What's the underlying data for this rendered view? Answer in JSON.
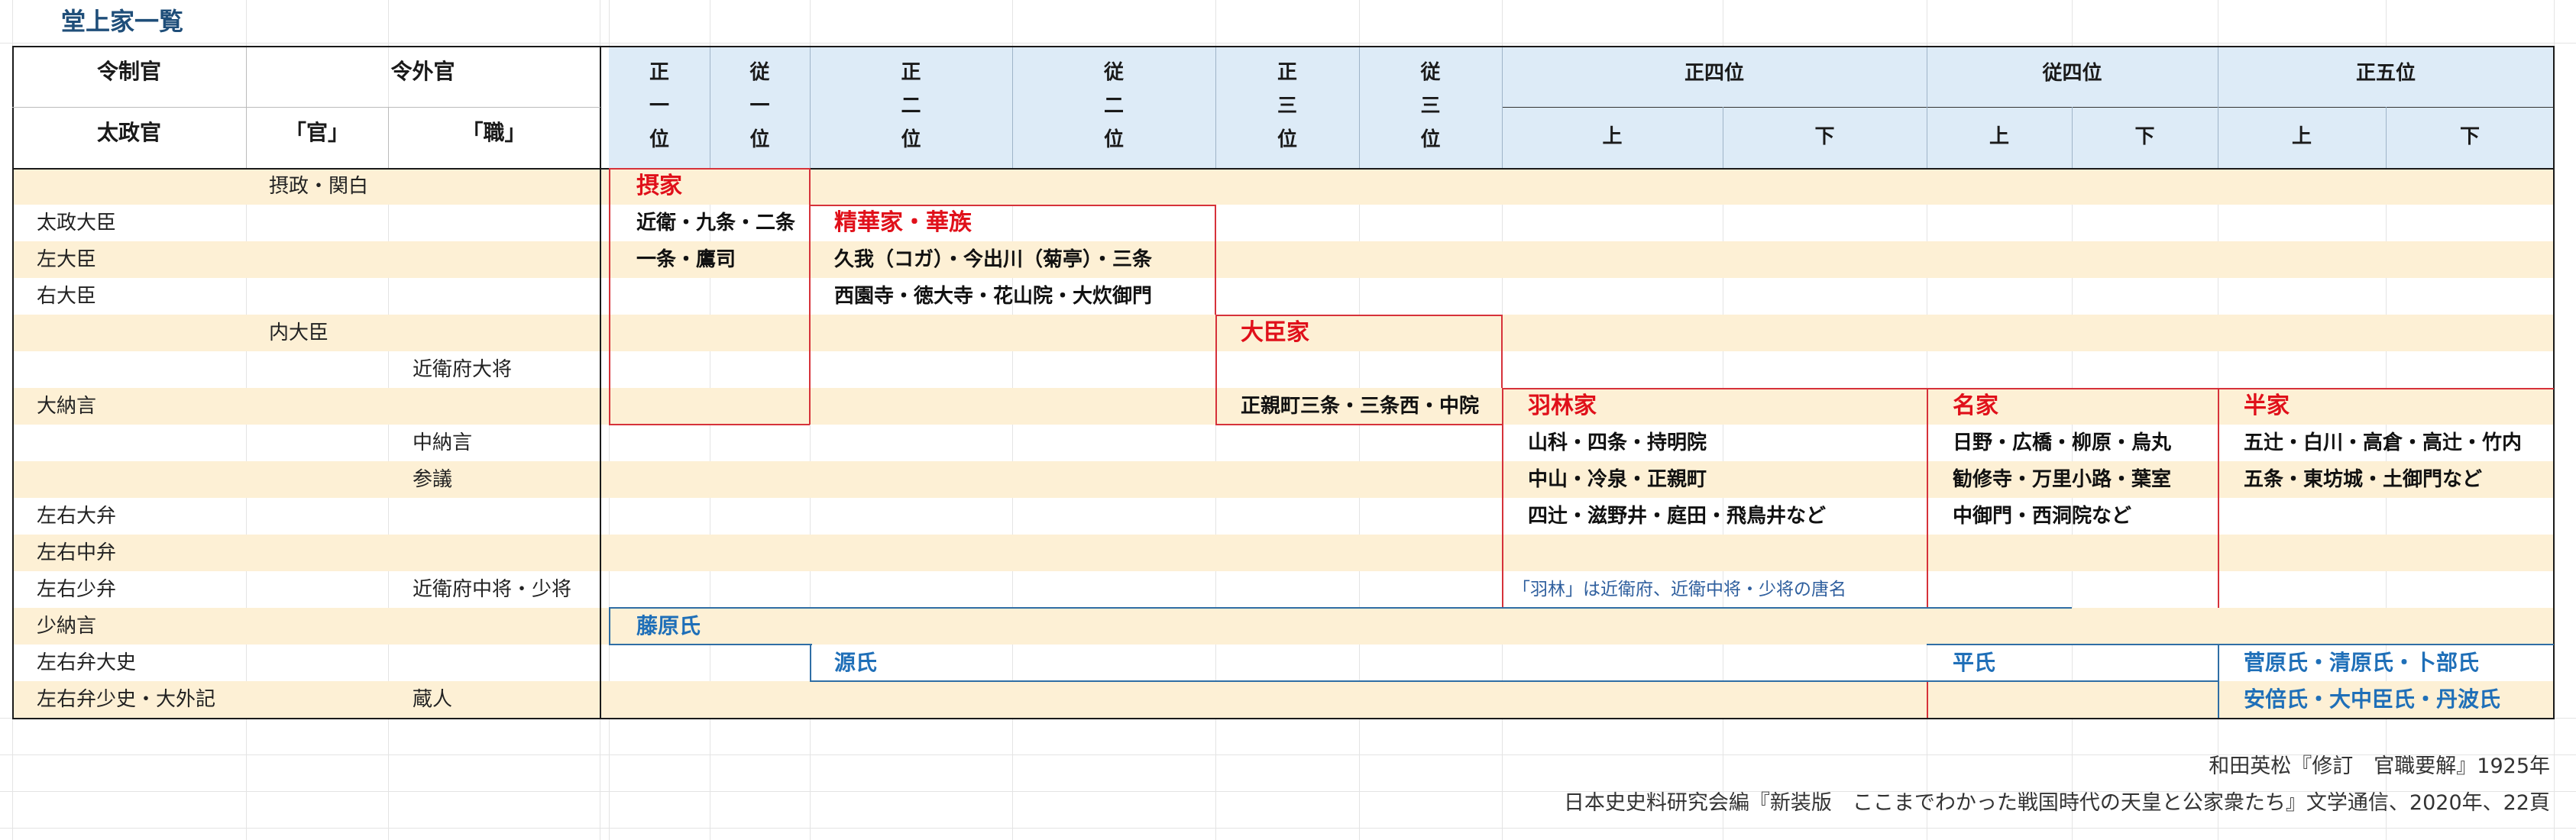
{
  "title": "堂上家一覧",
  "header": {
    "row1_left": [
      "令制官",
      "令外官"
    ],
    "row2_left": [
      "太政官",
      "「官」",
      "「職」"
    ],
    "ranks_vertical": [
      [
        "正",
        "一",
        "位"
      ],
      [
        "従",
        "一",
        "位"
      ],
      [
        "正",
        "二",
        "位"
      ],
      [
        "従",
        "二",
        "位"
      ],
      [
        "正",
        "三",
        "位"
      ],
      [
        "従",
        "三",
        "位"
      ]
    ],
    "ranks_split": [
      "正四位",
      "従四位",
      "正五位"
    ],
    "upper": "上",
    "lower": "下"
  },
  "rows": [
    {
      "ritsuryo": "",
      "kan": "摂政・関白",
      "shiki": ""
    },
    {
      "ritsuryo": "太政大臣",
      "kan": "",
      "shiki": ""
    },
    {
      "ritsuryo": "左大臣",
      "kan": "",
      "shiki": ""
    },
    {
      "ritsuryo": "右大臣",
      "kan": "",
      "shiki": ""
    },
    {
      "ritsuryo": "",
      "kan": "内大臣",
      "shiki": ""
    },
    {
      "ritsuryo": "",
      "kan": "",
      "shiki": "近衛府大将"
    },
    {
      "ritsuryo": "大納言",
      "kan": "",
      "shiki": ""
    },
    {
      "ritsuryo": "",
      "kan": "",
      "shiki": "中納言"
    },
    {
      "ritsuryo": "",
      "kan": "",
      "shiki": "参議"
    },
    {
      "ritsuryo": "左右大弁",
      "kan": "",
      "shiki": ""
    },
    {
      "ritsuryo": "左右中弁",
      "kan": "",
      "shiki": ""
    },
    {
      "ritsuryo": "左右少弁",
      "kan": "",
      "shiki": "近衛府中将・少将"
    },
    {
      "ritsuryo": "少納言",
      "kan": "",
      "shiki": ""
    },
    {
      "ritsuryo": "左右弁大史",
      "kan": "",
      "shiki": ""
    },
    {
      "ritsuryo": "左右弁少史・大外記",
      "kan": "",
      "shiki": "蔵人"
    }
  ],
  "groups": {
    "sekke": {
      "name": "摂家",
      "members": [
        "近衛・九条・二条",
        "一条・鷹司"
      ]
    },
    "seigake": {
      "name": "精華家・華族",
      "members": [
        "久我（コガ）・今出川（菊亭）・三条",
        "西園寺・徳大寺・花山院・大炊御門"
      ]
    },
    "daijinke": {
      "name": "大臣家",
      "members": [
        "正親町三条・三条西・中院"
      ]
    },
    "urinke": {
      "name": "羽林家",
      "members": [
        "山科・四条・持明院",
        "中山・冷泉・正親町",
        "四辻・滋野井・庭田・飛鳥井など"
      ],
      "note": "「羽林」は近衛府、近衛中将・少将の唐名"
    },
    "meike": {
      "name": "名家",
      "members": [
        "日野・広橋・柳原・烏丸",
        "勧修寺・万里小路・葉室",
        "中御門・西洞院など"
      ]
    },
    "hanke": {
      "name": "半家",
      "members": [
        "五辻・白川・高倉・高辻・竹内",
        "五条・東坊城・土御門など"
      ]
    }
  },
  "clans": {
    "fujiwara": "藤原氏",
    "minamoto": "源氏",
    "taira": "平氏",
    "others_1": "菅原氏・清原氏・卜部氏",
    "others_2": "安倍氏・大中臣氏・丹波氏"
  },
  "sources": [
    "和田英松『修訂　官職要解』1925年",
    "日本史史料研究会編『新装版　ここまでわかった戦国時代の天皇と公家衆たち』文学通信、2020年、22頁"
  ]
}
